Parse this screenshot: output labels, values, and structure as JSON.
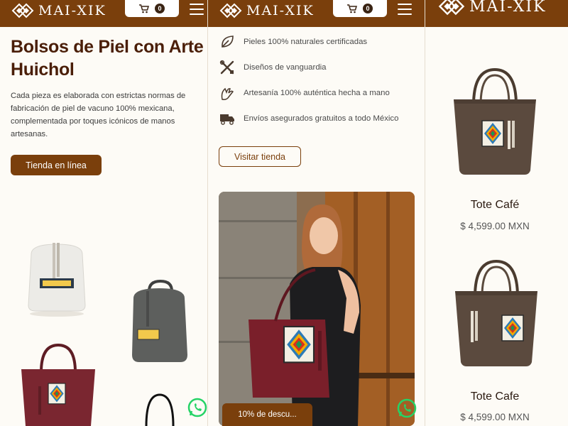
{
  "brand": {
    "name": "MAI-XIK"
  },
  "cart": {
    "count": "0"
  },
  "colors": {
    "primary": "#7a3f0c",
    "whatsapp": "#25d366",
    "background": "#fdfbf6"
  },
  "hero": {
    "title_bold": "Bolsos",
    "title_rest": " de Piel con Arte Huichol",
    "description": "Cada pieza es elaborada con estrictas normas de fabricación de piel de vacuno 100% mexicana, complementada por toques icónicos de manos artesanas.",
    "cta_label": "Tienda en línea"
  },
  "features": [
    {
      "icon": "leaf-icon",
      "label": "Pieles 100% naturales certificadas"
    },
    {
      "icon": "tools-icon",
      "label": "Diseños de vanguardia"
    },
    {
      "icon": "handcraft-icon",
      "label": "Artesanía 100% auténtica hecha a mano"
    },
    {
      "icon": "truck-icon",
      "label": "Envíos asegurados gratuitos a todo México"
    }
  ],
  "visit": {
    "label": "Visitar tienda"
  },
  "promo": {
    "label": "10% de descu..."
  },
  "products": [
    {
      "name": "Tote Café",
      "price": "$ 4,599.00 MXN"
    },
    {
      "name": "Tote Cafe",
      "price": "$ 4,599.00 MXN"
    }
  ]
}
